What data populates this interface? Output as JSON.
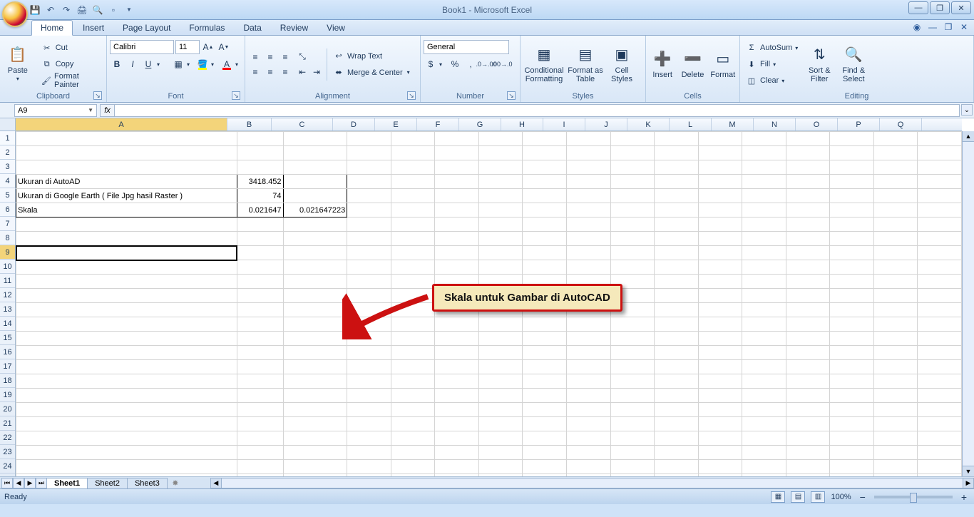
{
  "title": "Book1 - Microsoft Excel",
  "tabs": {
    "home": "Home",
    "insert": "Insert",
    "pagelayout": "Page Layout",
    "formulas": "Formulas",
    "data": "Data",
    "review": "Review",
    "view": "View"
  },
  "ribbon": {
    "clipboard": {
      "paste": "Paste",
      "cut": "Cut",
      "copy": "Copy",
      "format_painter": "Format Painter",
      "label": "Clipboard"
    },
    "font": {
      "name": "Calibri",
      "size": "11",
      "label": "Font"
    },
    "alignment": {
      "wrap": "Wrap Text",
      "merge": "Merge & Center",
      "label": "Alignment"
    },
    "number": {
      "format": "General",
      "label": "Number"
    },
    "styles": {
      "cond": "Conditional Formatting",
      "table": "Format as Table",
      "cell": "Cell Styles",
      "label": "Styles"
    },
    "cells": {
      "insert": "Insert",
      "delete": "Delete",
      "format": "Format",
      "label": "Cells"
    },
    "editing": {
      "autosum": "AutoSum",
      "fill": "Fill",
      "clear": "Clear",
      "sort": "Sort & Filter",
      "find": "Find & Select",
      "label": "Editing"
    }
  },
  "namebox": "A9",
  "formula": "",
  "columns": [
    "A",
    "B",
    "C",
    "D",
    "E",
    "F",
    "G",
    "H",
    "I",
    "J",
    "K",
    "L",
    "M",
    "N",
    "O",
    "P",
    "Q"
  ],
  "col_widths": {
    "A": 297,
    "B": 62,
    "C": 86,
    "other": 59
  },
  "rows_shown": 25,
  "active_cell": "A9",
  "sheet_data": {
    "r4": {
      "A": "Ukuran di AutoAD",
      "B": "3418.452",
      "C": ""
    },
    "r5": {
      "A": "Ukuran di Google Earth ( File Jpg hasil Raster )",
      "B": "74",
      "C": ""
    },
    "r6": {
      "A": "Skala",
      "B": "0.021647",
      "C": "0.021647223"
    }
  },
  "callout": "Skala untuk Gambar di AutoCAD",
  "sheets": {
    "s1": "Sheet1",
    "s2": "Sheet2",
    "s3": "Sheet3"
  },
  "status": {
    "ready": "Ready",
    "zoom": "100%"
  }
}
